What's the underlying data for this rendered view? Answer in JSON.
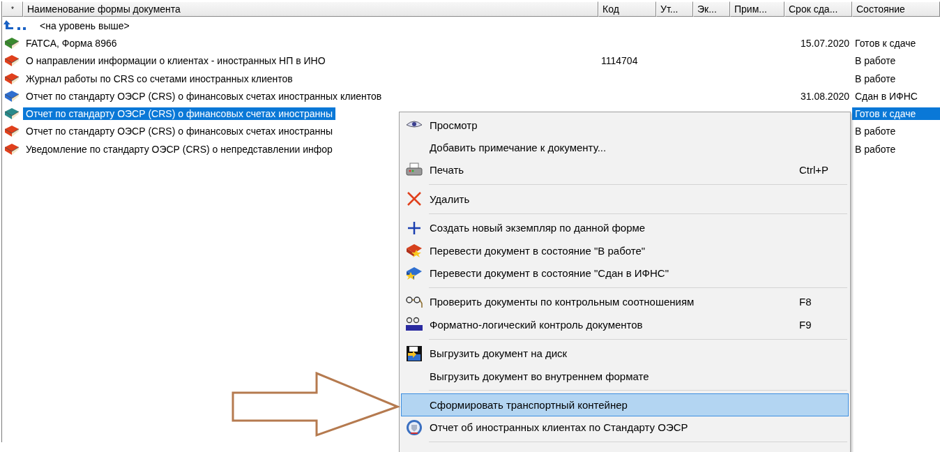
{
  "table": {
    "columns": [
      "*",
      "Наименование формы документа",
      "Код",
      "Ут...",
      "Эк...",
      "Прим...",
      "Срок сда...",
      "Состояние"
    ],
    "rows": [
      {
        "kind": "up",
        "name": "<на уровень выше>",
        "selected": false
      },
      {
        "kind": "document",
        "color": "#3a8a2e",
        "name": "FATCA, Форма 8966",
        "code": "",
        "date": "15.07.2020",
        "status": "Готов к сдаче",
        "selected": false
      },
      {
        "kind": "document",
        "color": "#e0401c",
        "name": "О направлении информации о клиентах - иностранных НП в ИНО",
        "code": "1114704",
        "date": "",
        "status": "В работе",
        "selected": false
      },
      {
        "kind": "document",
        "color": "#e0401c",
        "name": "Журнал работы по CRS со счетами иностранных клиентов",
        "code": "",
        "date": "",
        "status": "В работе",
        "selected": false
      },
      {
        "kind": "document",
        "color": "#2f6fd0",
        "name": "Отчет по стандарту ОЭСР (CRS) о финансовых счетах иностранных клиентов",
        "code": "",
        "date": "31.08.2020",
        "status": "Сдан в ИФНС",
        "selected": false
      },
      {
        "kind": "document",
        "color": "#2a8a8a",
        "name": "Отчет по стандарту ОЭСР (CRS) о финансовых счетах иностранны",
        "code": "",
        "date": "",
        "status": "Готов к сдаче",
        "selected": true
      },
      {
        "kind": "document",
        "color": "#e0401c",
        "name": "Отчет по стандарту ОЭСР (CRS) о финансовых счетах иностранны",
        "code": "",
        "date": "",
        "status": "В работе",
        "selected": false
      },
      {
        "kind": "document",
        "color": "#e0401c",
        "name": "Уведомление по стандарту ОЭСР (CRS) о непредставлении инфор",
        "code": "",
        "date": "",
        "status": "В работе",
        "selected": false
      }
    ]
  },
  "context_menu": {
    "items": [
      {
        "kind": "item",
        "label": "Просмотр",
        "selected": false
      },
      {
        "kind": "item",
        "label": "Добавить примечание к документу...",
        "selected": false
      },
      {
        "kind": "item",
        "label": "Печать",
        "shortcut": "Ctrl+P",
        "selected": false
      },
      {
        "kind": "separator"
      },
      {
        "kind": "item",
        "label": "Удалить",
        "selected": false
      },
      {
        "kind": "separator"
      },
      {
        "kind": "item",
        "label": "Создать новый экземпляр по данной форме",
        "selected": false
      },
      {
        "kind": "item",
        "label": "Перевести документ в состояние \"В работе\"",
        "selected": false
      },
      {
        "kind": "item",
        "label": "Перевести документ в состояние \"Сдан в ИФНС\"",
        "selected": false
      },
      {
        "kind": "separator"
      },
      {
        "kind": "item",
        "label": "Проверить документы по контрольным соотношениям",
        "shortcut": "F8",
        "selected": false
      },
      {
        "kind": "item",
        "label": "Форматно-логический контроль документов",
        "shortcut": "F9",
        "selected": false
      },
      {
        "kind": "separator"
      },
      {
        "kind": "item",
        "label": "Выгрузить документ на диск",
        "selected": false
      },
      {
        "kind": "item",
        "label": "Выгрузить документ во внутреннем формате",
        "selected": false
      },
      {
        "kind": "separator"
      },
      {
        "kind": "item",
        "label": "Сформировать транспортный контейнер",
        "selected": true
      },
      {
        "kind": "item",
        "label": "Отчет об иностранных клиентах по Стандарту ОЭСР",
        "selected": false
      },
      {
        "kind": "separator"
      }
    ]
  }
}
